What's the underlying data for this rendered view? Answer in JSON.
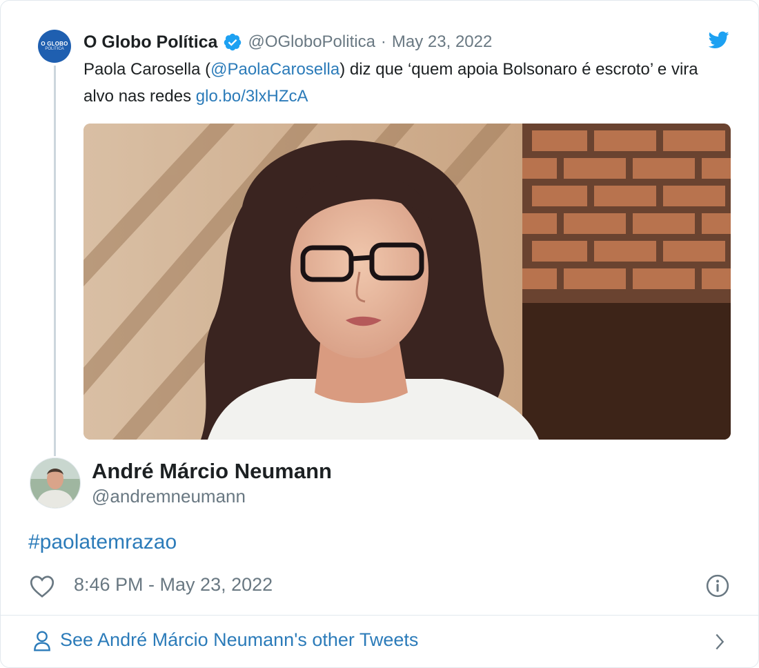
{
  "quoted": {
    "avatar_line1": "O GLOBO",
    "avatar_line2": "POLÍTICA",
    "name": "O Globo Política",
    "handle": "@OGloboPolitica",
    "separator": "·",
    "date": "May 23, 2022",
    "text_before": "Paola Carosella (",
    "mention": "@PaolaCarosella",
    "text_after": ") diz que ‘quem apoia Bolsonaro é escroto’ e vira alvo nas redes ",
    "link": "glo.bo/3lxHZcA",
    "verified_icon": "verified-badge-icon",
    "brand_color": "#1da1f2"
  },
  "main": {
    "name": "André Márcio Neumann",
    "handle": "@andremneumann",
    "hashtag": "#paolatemrazao",
    "timestamp": "8:46 PM - May 23, 2022"
  },
  "footer": {
    "label": "See André Márcio Neumann's other Tweets"
  },
  "colors": {
    "link": "#2b7bb9",
    "muted": "#697882",
    "border": "#e1e8ed"
  }
}
